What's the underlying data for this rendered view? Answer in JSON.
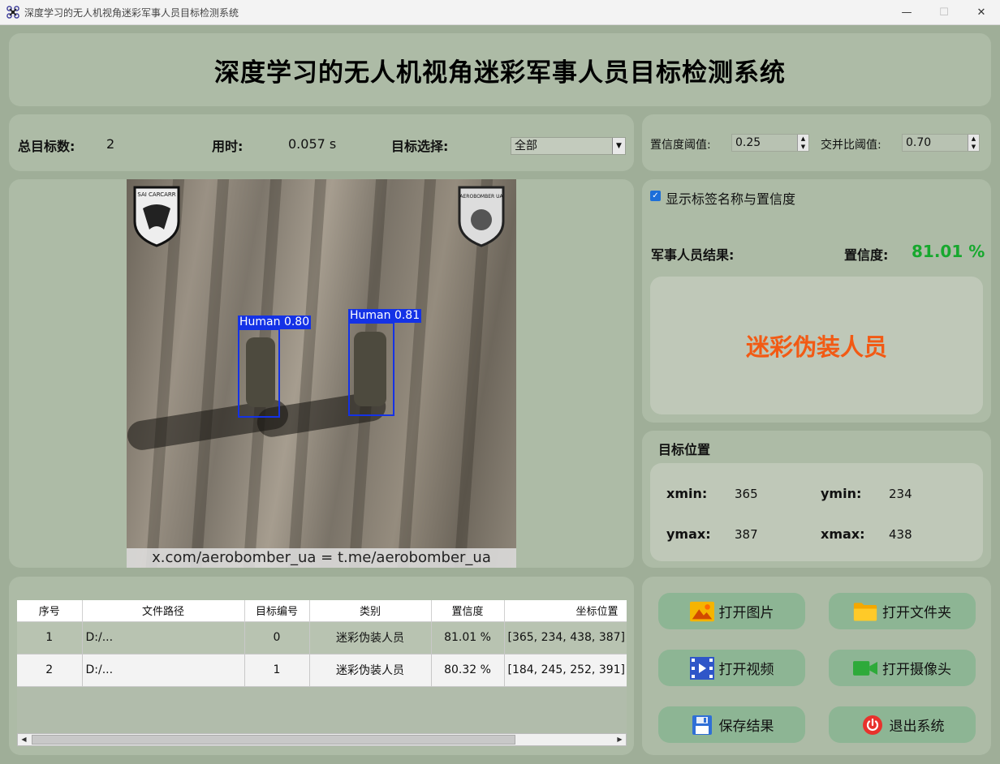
{
  "window": {
    "title": "深度学习的无人机视角迷彩军事人员目标检测系统",
    "min": "—",
    "max": "☐",
    "close": "✕"
  },
  "header": {
    "title": "深度学习的无人机视角迷彩军事人员目标检测系统"
  },
  "stats": {
    "total_label": "总目标数:",
    "total_value": "2",
    "time_label": "用时:",
    "time_value": "0.057 s",
    "select_label": "目标选择:",
    "select_value": "全部"
  },
  "thresholds": {
    "conf_label": "置信度阈值:",
    "conf_value": "0.25",
    "iou_label": "交并比阈值:",
    "iou_value": "0.70"
  },
  "image": {
    "detections": [
      {
        "label": "Human 0.80"
      },
      {
        "label": "Human 0.81"
      }
    ],
    "watermark": "x.com/aerobomber_ua  =  t.me/aerobomber_ua",
    "logo_left_text": "SAI CARCARR",
    "logo_right_text": "AEROBOMBER UA"
  },
  "result": {
    "checkbox_label": "显示标签名称与置信度",
    "checked": true,
    "result_label": "军事人员结果:",
    "conf_label": "置信度:",
    "conf_value": "81.01 %",
    "class_text": "迷彩伪装人员"
  },
  "position": {
    "title": "目标位置",
    "xmin_label": "xmin:",
    "xmin": "365",
    "ymin_label": "ymin:",
    "ymin": "234",
    "ymax_label": "ymax:",
    "ymax": "387",
    "xmax_label": "xmax:",
    "xmax": "438"
  },
  "table": {
    "headers": [
      "序号",
      "文件路径",
      "目标编号",
      "类别",
      "置信度",
      "坐标位置"
    ],
    "rows": [
      [
        "1",
        "D:/...",
        "0",
        "迷彩伪装人员",
        "81.01 %",
        "[365, 234, 438, 387]"
      ],
      [
        "2",
        "D:/...",
        "1",
        "迷彩伪装人员",
        "80.32 %",
        "[184, 245, 252, 391]"
      ]
    ]
  },
  "buttons": {
    "open_image": "打开图片",
    "open_folder": "打开文件夹",
    "open_video": "打开视频",
    "open_camera": "打开摄像头",
    "save_result": "保存结果",
    "exit": "退出系统"
  },
  "colors": {
    "accent_green": "#17a82e",
    "result_orange": "#f25a14",
    "box_blue": "#1432e6",
    "button_bg": "#8db594"
  }
}
